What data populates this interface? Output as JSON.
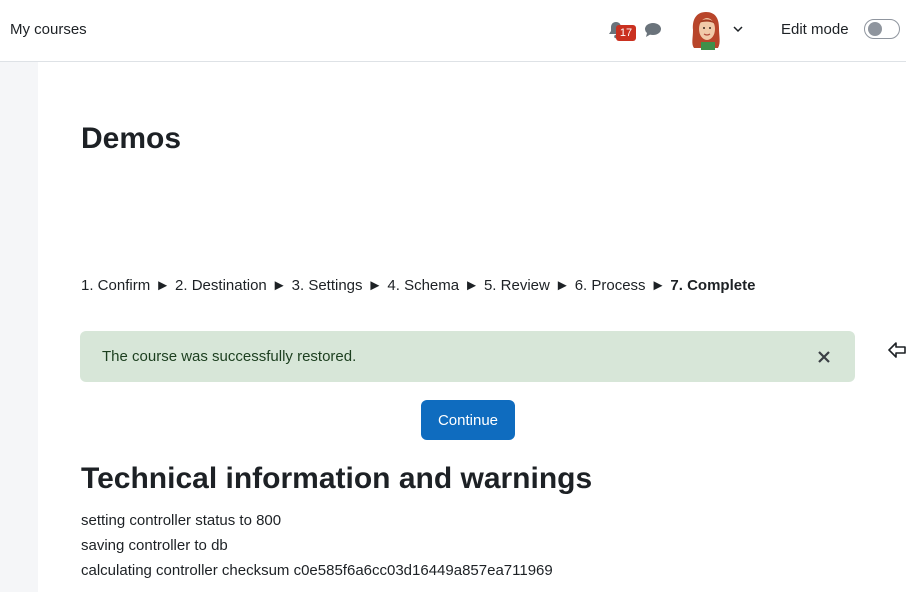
{
  "navbar": {
    "my_courses": "My courses",
    "notification_count": "17",
    "edit_mode_label": "Edit mode",
    "edit_mode_on": false
  },
  "page": {
    "title": "Demos"
  },
  "steps": [
    {
      "label": "1. Confirm",
      "current": false
    },
    {
      "label": "2. Destination",
      "current": false
    },
    {
      "label": "3. Settings",
      "current": false
    },
    {
      "label": "4. Schema",
      "current": false
    },
    {
      "label": "5. Review",
      "current": false
    },
    {
      "label": "6. Process",
      "current": false
    },
    {
      "label": "7. Complete",
      "current": true
    }
  ],
  "step_separator": "►",
  "alert": {
    "message": "The course was successfully restored.",
    "close_symbol": "×"
  },
  "continue_button": "Continue",
  "technical": {
    "heading": "Technical information and warnings",
    "lines": [
      "setting controller status to 800",
      "saving controller to db",
      "calculating controller checksum c0e585f6a6cc03d16449a857ea711969"
    ]
  },
  "colors": {
    "primary": "#0f6cbf",
    "success_bg": "#d7e6d8",
    "badge": "#ca3120"
  },
  "icons": {
    "bell": "bell-icon",
    "chat": "chat-icon",
    "avatar": "user-avatar",
    "chevron": "chevron-down-icon",
    "close": "close-icon",
    "side": "arrow-left-icon"
  }
}
